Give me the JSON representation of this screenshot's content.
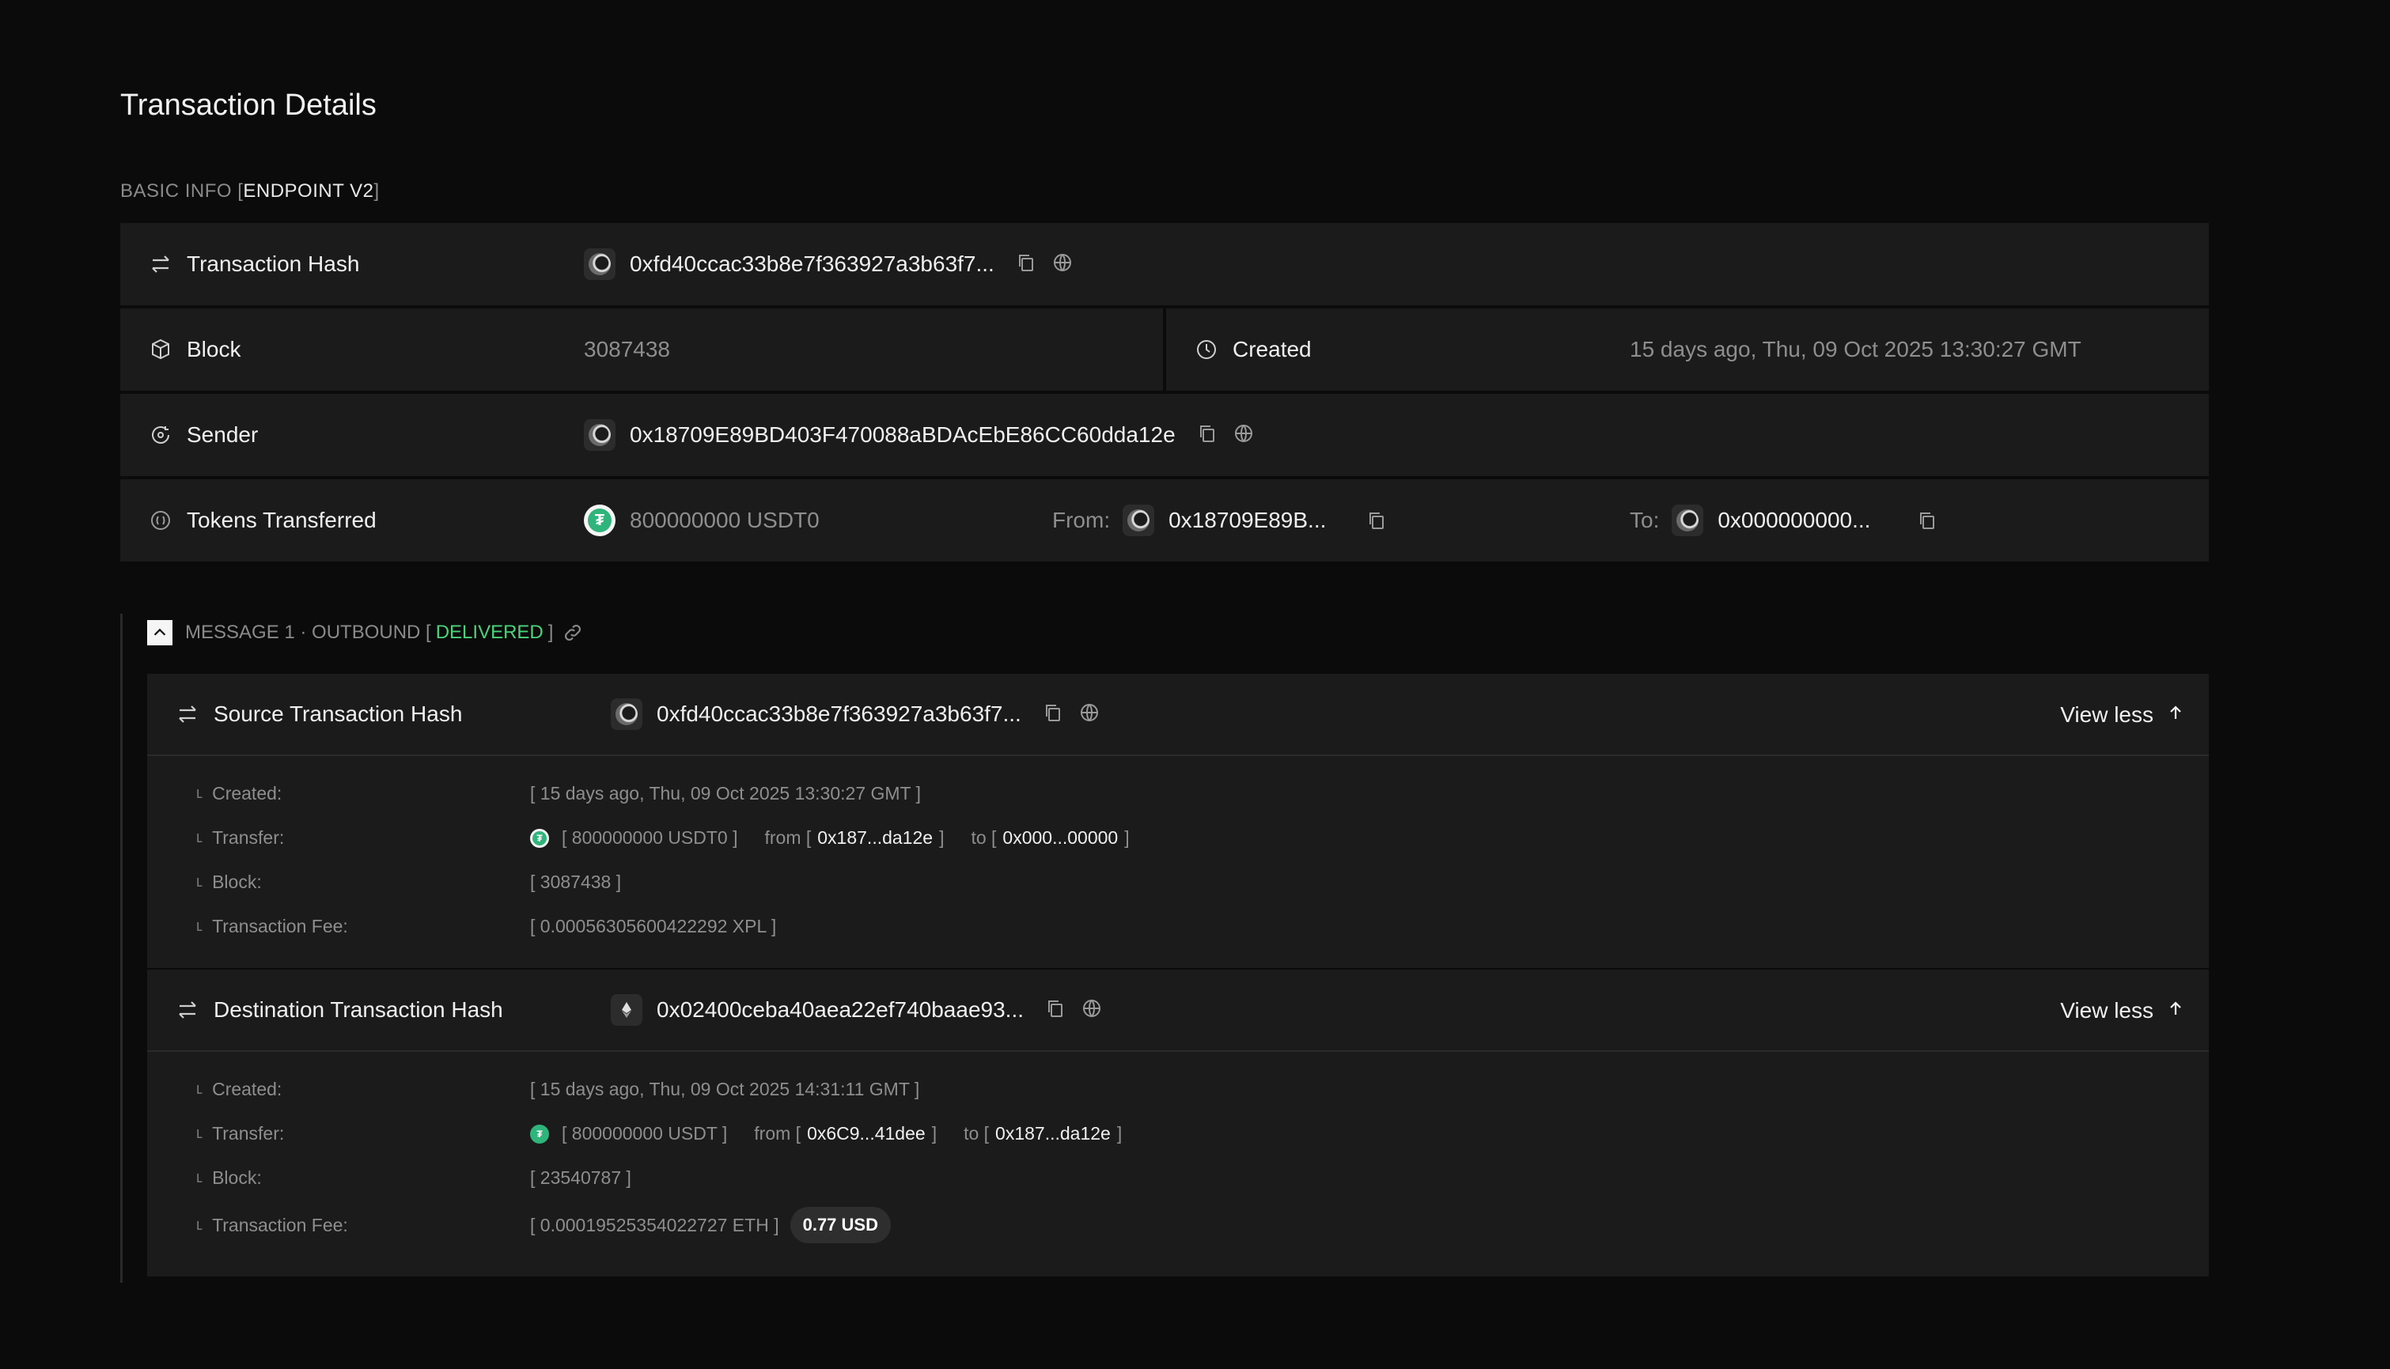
{
  "page": {
    "title": "Transaction Details"
  },
  "basic_info": {
    "label_prefix": "BASIC INFO [",
    "label_highlight": "ENDPOINT V2",
    "label_suffix": "]",
    "transaction_hash": {
      "label": "Transaction Hash",
      "value": "0xfd40ccac33b8e7f363927a3b63f7..."
    },
    "block": {
      "label": "Block",
      "value": "3087438"
    },
    "created": {
      "label": "Created",
      "value": "15 days ago, Thu, 09 Oct 2025 13:30:27 GMT"
    },
    "sender": {
      "label": "Sender",
      "value": "0x18709E89BD403F470088aBDAcEbE86CC60dda12e"
    },
    "tokens_transferred": {
      "label": "Tokens Transferred",
      "amount": "800000000 USDT0",
      "from_label": "From:",
      "from_value": "0x18709E89B...",
      "to_label": "To:",
      "to_value": "0x000000000..."
    }
  },
  "message": {
    "prefix": "MESSAGE 1 · OUTBOUND [",
    "status": "DELIVERED",
    "suffix": "]",
    "status_color": "#4bd37b",
    "source": {
      "label": "Source Transaction Hash",
      "hash": "0xfd40ccac33b8e7f363927a3b63f7...",
      "view_less": "View less",
      "created_key": "Created:",
      "created_val": "[ 15 days ago, Thu, 09 Oct 2025 13:30:27 GMT ]",
      "transfer_key": "Transfer:",
      "transfer_amount": "[ 800000000 USDT0 ]",
      "transfer_from_pre": "from [",
      "transfer_from": "0x187...da12e",
      "transfer_from_post": "]",
      "transfer_to_pre": "to [",
      "transfer_to": "0x000...00000",
      "transfer_to_post": "]",
      "block_key": "Block:",
      "block_val": "[ 3087438 ]",
      "fee_key": "Transaction Fee:",
      "fee_val": "[ 0.00056305600422292 XPL ]"
    },
    "destination": {
      "label": "Destination Transaction Hash",
      "hash": "0x02400ceba40aea22ef740baae93...",
      "view_less": "View less",
      "created_key": "Created:",
      "created_val": "[ 15 days ago, Thu, 09 Oct 2025 14:31:11 GMT ]",
      "transfer_key": "Transfer:",
      "transfer_amount": "[ 800000000 USDT ]",
      "transfer_from_pre": "from [",
      "transfer_from": "0x6C9...41dee",
      "transfer_from_post": "]",
      "transfer_to_pre": "to [",
      "transfer_to": "0x187...da12e",
      "transfer_to_post": "]",
      "block_key": "Block:",
      "block_val": "[ 23540787 ]",
      "fee_key": "Transaction Fee:",
      "fee_val": "[ 0.00019525354022727 ETH ]",
      "fee_usd": "0.77 USD"
    }
  },
  "icons": {
    "transfer": "swap-arrows-icon",
    "block": "cube-icon",
    "created": "clock-icon",
    "sender": "sender-icon",
    "tokens": "coin-icon",
    "copy": "copy-icon",
    "explorer": "globe-icon",
    "link": "link-icon",
    "chevron": "chevron-up-icon",
    "arrow_up": "arrow-up-icon"
  },
  "token_glyph": "₮"
}
